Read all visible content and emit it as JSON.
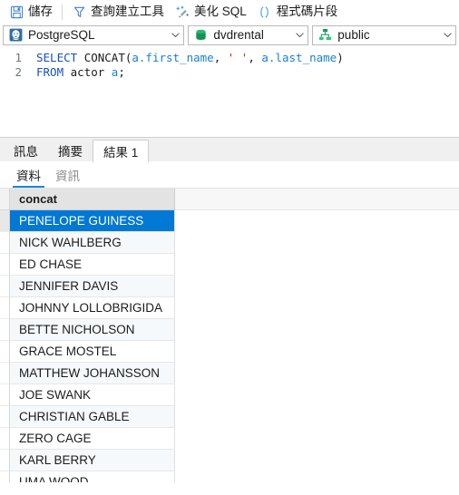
{
  "toolbar": {
    "buttons": [
      {
        "icon": "save-icon",
        "label": "儲存"
      },
      {
        "icon": "query-builder-icon",
        "label": "查詢建立工具"
      },
      {
        "icon": "beautify-sql-icon",
        "label": "美化 SQL"
      },
      {
        "icon": "code-snippet-icon",
        "label": "程式碼片段"
      }
    ]
  },
  "connection_bar": {
    "driver": {
      "icon": "postgresql-icon",
      "value": "PostgreSQL"
    },
    "database": {
      "icon": "database-icon",
      "value": "dvdrental"
    },
    "schema": {
      "icon": "schema-icon",
      "value": "public"
    }
  },
  "editor": {
    "line_numbers": [
      "1",
      "2"
    ],
    "lines": [
      [
        {
          "t": "SELECT ",
          "c": "kw"
        },
        {
          "t": "CONCAT",
          "c": "fn"
        },
        {
          "t": "(",
          "c": "pun"
        },
        {
          "t": "a.first_name",
          "c": "ident"
        },
        {
          "t": ", ",
          "c": "pun"
        },
        {
          "t": "' '",
          "c": "str"
        },
        {
          "t": ", ",
          "c": "pun"
        },
        {
          "t": "a.last_name",
          "c": "ident"
        },
        {
          "t": ")",
          "c": "pun"
        }
      ],
      [
        {
          "t": "FROM ",
          "c": "kw"
        },
        {
          "t": "actor ",
          "c": "fn"
        },
        {
          "t": "a",
          "c": "ident"
        },
        {
          "t": ";",
          "c": "pun"
        }
      ]
    ],
    "raw_sql": "SELECT CONCAT(a.first_name, ' ', a.last_name)\nFROM actor a;"
  },
  "result_panel": {
    "tabs": [
      {
        "label": "訊息",
        "active": false
      },
      {
        "label": "摘要",
        "active": false
      },
      {
        "label": "結果 1",
        "active": true
      }
    ],
    "subtabs": [
      {
        "label": "資料",
        "active": true
      },
      {
        "label": "資訊",
        "active": false
      }
    ],
    "grid": {
      "columns": [
        "concat"
      ],
      "selected_row_index": 0,
      "rows": [
        [
          "PENELOPE GUINESS"
        ],
        [
          "NICK WAHLBERG"
        ],
        [
          "ED CHASE"
        ],
        [
          "JENNIFER DAVIS"
        ],
        [
          "JOHNNY LOLLOBRIGIDA"
        ],
        [
          "BETTE NICHOLSON"
        ],
        [
          "GRACE MOSTEL"
        ],
        [
          "MATTHEW JOHANSSON"
        ],
        [
          "JOE SWANK"
        ],
        [
          "CHRISTIAN GABLE"
        ],
        [
          "ZERO CAGE"
        ],
        [
          "KARL BERRY"
        ],
        [
          "UMA WOOD"
        ]
      ]
    }
  },
  "colors": {
    "accent": "#0078d4",
    "subtab_underline": "#1b87d8",
    "keyword": "#1750bd",
    "identifier": "#1b7fd4",
    "string": "#c9291f",
    "header_bg": "#e3e3e3",
    "alt_row_bg": "#f6f9fc"
  }
}
